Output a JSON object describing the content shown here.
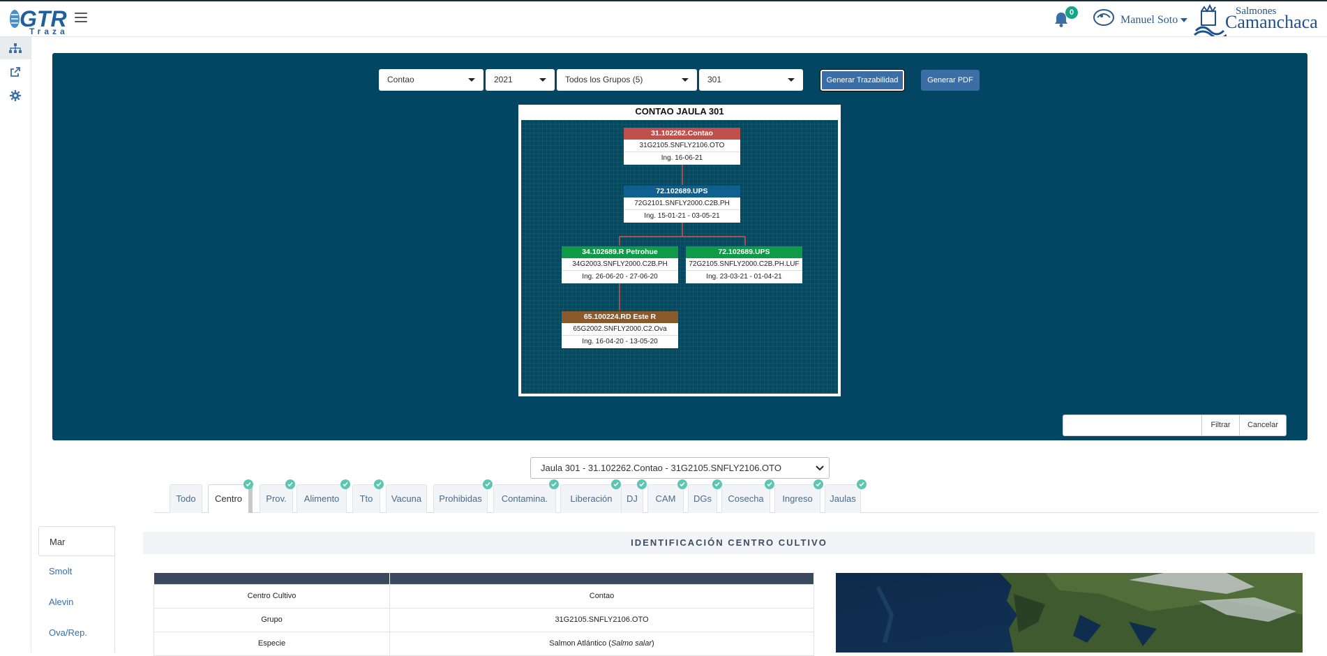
{
  "header": {
    "logo_text": "GTR",
    "logo_sub": "Traza",
    "notifications_count": "0",
    "user_name": "Manuel Soto",
    "brand_top": "Salmones",
    "brand_main": "Camanchaca"
  },
  "sidebar": {
    "items": [
      {
        "icon": "sitemap-icon"
      },
      {
        "icon": "external-link-icon"
      },
      {
        "icon": "gear-icon"
      }
    ]
  },
  "filters": {
    "centro": "Contao",
    "year": "2021",
    "grupo": "Todos los Grupos (5)",
    "jaula": "301",
    "generate_label": "Generar Trazabilidad",
    "pdf_label": "Generar PDF",
    "filter_label": "Filtrar",
    "cancel_label": "Cancelar"
  },
  "tree": {
    "title": "CONTAO JAULA 301",
    "nodes": [
      {
        "title": "31.102262.Contao",
        "group": "31G2105.SNFLY2106.OTO",
        "dates": "Ing. 16-06-21",
        "color": "#c0504d"
      },
      {
        "title": "72.102689.UPS",
        "group": "72G2101.SNFLY2000.C2B.PH",
        "dates": "Ing. 15-01-21 - 03-05-21",
        "color": "#0f5f8f"
      },
      {
        "title": "34.102689.R Petrohue",
        "group": "34G2003.SNFLY2000.C2B.PH",
        "dates": "Ing. 26-06-20 - 27-06-20",
        "color": "#0f9a48"
      },
      {
        "title": "72.102689.UPS",
        "group": "72G2105.SNFLY2000.C2B.PH.LUF",
        "dates": "Ing. 23-03-21 - 01-04-21",
        "color": "#0f9a48"
      },
      {
        "title": "65.100224.RD Este R",
        "group": "65G2002.SNFLY2000.C2.Ova",
        "dates": "Ing. 16-04-20 - 13-05-20",
        "color": "#8a5a2b"
      }
    ]
  },
  "jaula_select": "Jaula 301 - 31.102262.Contao - 31G2105.SNFLY2106.OTO",
  "tabs": [
    "Todo",
    "Centro",
    "Prov.",
    "Alimento",
    "Tto",
    "Vacuna",
    "Prohibidas",
    "Contamina.",
    "Liberación",
    "DJ",
    "CAM",
    "DGs",
    "Cosecha",
    "Ingreso",
    "Jaulas"
  ],
  "side_tabs": [
    "Mar",
    "Smolt",
    "Alevin",
    "Ova/Rep."
  ],
  "section_title": "IDENTIFICACIÓN CENTRO CULTIVO",
  "table": {
    "rows": [
      {
        "label": "Centro Cultivo",
        "value": "Contao"
      },
      {
        "label": "Grupo",
        "value": "31G2105.SNFLY2106.OTO"
      },
      {
        "label": "Especie",
        "value": "Salmon Atlántico (",
        "value_em": "Salmo salar",
        "value_end": ")"
      }
    ]
  },
  "colors": {
    "panel": "#034663",
    "accent": "#3a6ea5",
    "check": "#5cc6b3"
  }
}
